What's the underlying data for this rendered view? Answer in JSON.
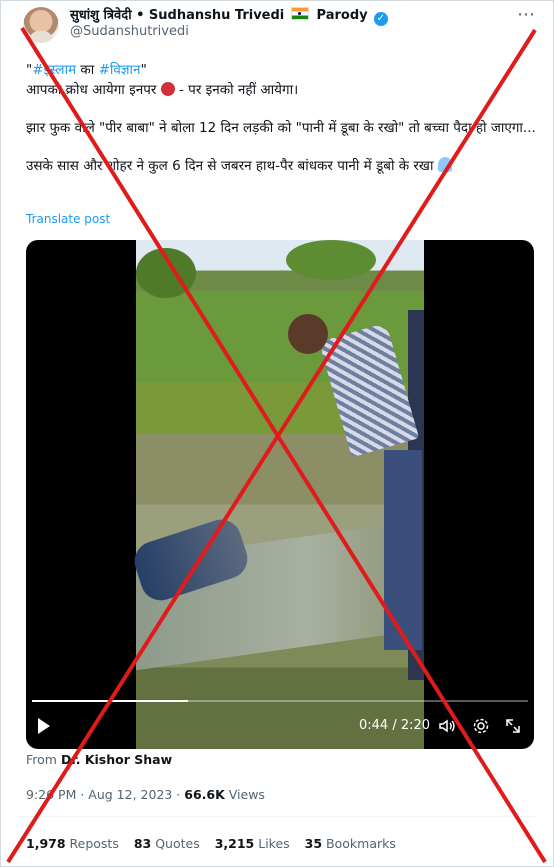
{
  "post": {
    "author": {
      "name": "सुधांशु त्रिवेदी • Sudhanshu Trivedi",
      "badge": "Parody",
      "handle": "@Sudanshutrivedi"
    },
    "text": {
      "line1_prefix": "\"",
      "line1_tag1": "#इस्लाम",
      "line1_mid": " का ",
      "line1_tag2": "#विज्ञान",
      "line1_suffix": "\"",
      "line2_before": "आपको क्रोध आयेगा इनपर ",
      "line2_after": " - पर इनको नहीं आयेगा।",
      "para2": "झार फुक वाले \"पीर बाबा\" ने बोला 12 दिन लड़की को \"पानी में डूबा के रखो\" तो बच्चा पैदा हो जाएगा...",
      "para3": "उसके सास और शोहर ने कुल 6 दिन से जबरन हाथ-पैर बांधकर पानी में डूबो के रखा "
    },
    "translate_label": "Translate post",
    "video": {
      "current_time": "0:44",
      "separator": " / ",
      "duration": "2:20",
      "progress_fraction": 0.314
    },
    "from_label": "From",
    "from_source": "Dr. Kishor Shaw",
    "timestamp": "9:26 PM · Aug 12, 2023 · ",
    "views_count": "66.6K",
    "views_label": " Views",
    "stats": {
      "reposts_count": "1,978",
      "reposts_label": " Reposts",
      "quotes_count": "83",
      "quotes_label": " Quotes",
      "likes_count": "3,215",
      "likes_label": " Likes",
      "bookmarks_count": "35",
      "bookmarks_label": " Bookmarks"
    },
    "icons": {
      "verified": "verified-check-icon",
      "flag": "india-flag-icon",
      "more": "more-options-icon",
      "play": "play-icon",
      "volume": "volume-icon",
      "settings": "gear-icon",
      "fullscreen": "fullscreen-icon",
      "angry": "angry-face-emoji",
      "facepalm": "facepalm-emoji"
    },
    "colors": {
      "link": "#1d9bf0",
      "overlay_x": "#e01b1b"
    }
  }
}
